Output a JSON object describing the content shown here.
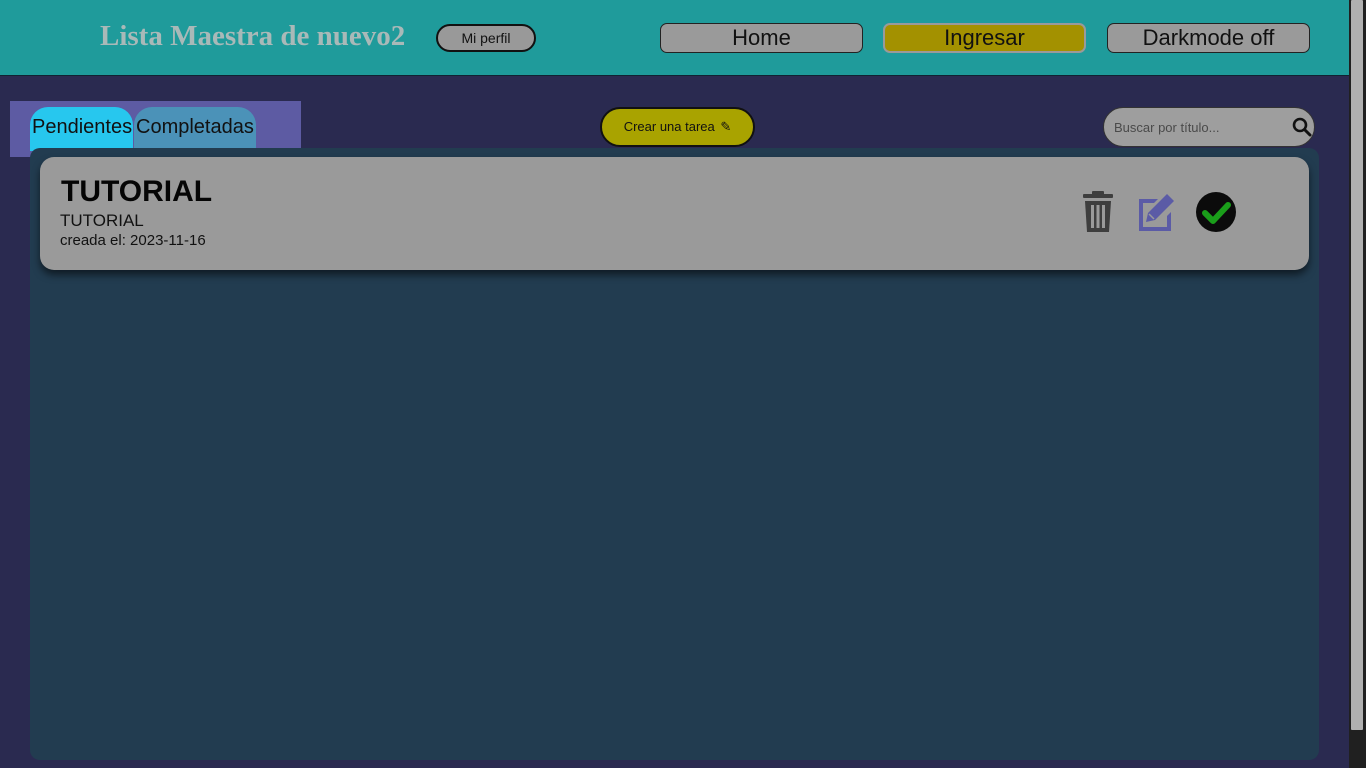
{
  "header": {
    "title": "Lista Maestra de nuevo2",
    "profile_label": "Mi perfil",
    "nav": {
      "home": "Home",
      "login": "Ingresar",
      "darkmode": "Darkmode off"
    }
  },
  "tabs": {
    "pending": "Pendientes",
    "completed": "Completadas"
  },
  "toolbar": {
    "create_label": "Crear una tarea",
    "search_placeholder": "Buscar por título..."
  },
  "tasks": [
    {
      "title": "TUTORIAL",
      "description": "TUTORIAL",
      "created_label": "creada el:",
      "created_date": "2023-11-16"
    }
  ],
  "icons": {
    "create": "pencil-icon",
    "search": "search-icon",
    "delete": "trash-icon",
    "edit": "edit-icon",
    "complete": "check-circle-icon"
  },
  "colors": {
    "header_bg": "#1f9b9b",
    "page_bg": "#2a2a50",
    "panel_bg": "#223c50",
    "accent_yellow": "#a9a300",
    "active_tab": "#27c7ee",
    "edit_icon": "#5b5ba6",
    "check_icon": "#1a9e1a"
  }
}
